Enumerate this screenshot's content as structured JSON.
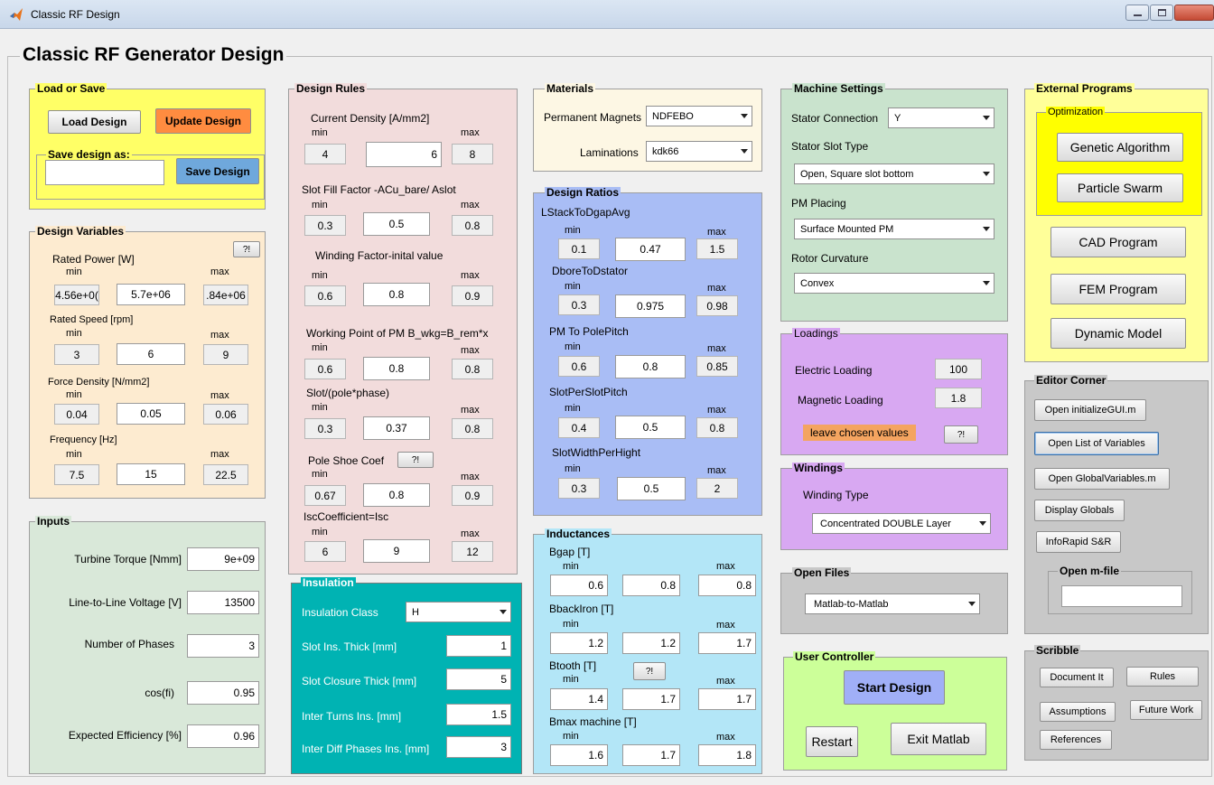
{
  "window": {
    "title": "Classic RF Design"
  },
  "main_title": "Classic RF Generator Design",
  "load_save": {
    "title": "Load or Save",
    "load": "Load Design",
    "update": "Update Design",
    "save_as_title": "Save design as:",
    "save": "Save Design",
    "filename": ""
  },
  "design_variables": {
    "title": "Design Variables",
    "help": "?!",
    "rows": [
      {
        "label": "Rated Power [W]",
        "min_label": "min",
        "max_label": "max",
        "min": "4.56e+0(",
        "value": "5.7e+06",
        "max": ".84e+06"
      },
      {
        "label": "Rated Speed [rpm]",
        "min_label": "min",
        "max_label": "max",
        "min": "3",
        "value": "6",
        "max": "9"
      },
      {
        "label": "Force Density [N/mm2]",
        "min_label": "min",
        "max_label": "max",
        "min": "0.04",
        "value": "0.05",
        "max": "0.06"
      },
      {
        "label": "Frequency [Hz]",
        "min_label": "min",
        "max_label": "max",
        "min": "7.5",
        "value": "15",
        "max": "22.5"
      }
    ]
  },
  "inputs": {
    "title": "Inputs",
    "rows": [
      {
        "label": "Turbine Torque [Nmm]",
        "value": "9e+09"
      },
      {
        "label": "Line-to-Line Voltage [V]",
        "value": "13500"
      },
      {
        "label": "Number of Phases",
        "value": "3"
      },
      {
        "label": "cos(fi)",
        "value": "0.95"
      },
      {
        "label": "Expected Efficiency [%]",
        "value": "0.96"
      }
    ]
  },
  "design_rules": {
    "title": "Design Rules",
    "help": "?!",
    "rows": [
      {
        "label": "Current Density [A/mm2]",
        "min_label": "min",
        "max_label": "max",
        "min": "4",
        "value": "6",
        "max": "8"
      },
      {
        "label": "Slot Fill Factor -ACu_bare/ Aslot",
        "min_label": "min",
        "max_label": "max",
        "min": "0.3",
        "value": "0.5",
        "max": "0.8"
      },
      {
        "label": "Winding Factor-inital value",
        "min_label": "min",
        "max_label": "max",
        "min": "0.6",
        "value": "0.8",
        "max": "0.9"
      },
      {
        "label": "Working Point of PM B_wkg=B_rem*x",
        "min_label": "min",
        "max_label": "max",
        "min": "0.6",
        "value": "0.8",
        "max": "0.8"
      },
      {
        "label": "Slot/(pole*phase)",
        "min_label": "min",
        "max_label": "max",
        "min": "0.3",
        "value": "0.37",
        "max": "0.8"
      },
      {
        "label": "Pole Shoe Coef",
        "min_label": "min",
        "max_label": "max",
        "min": "0.67",
        "value": "0.8",
        "max": "0.9"
      },
      {
        "label": "IscCoefficient=Isc",
        "min_label": "min",
        "max_label": "max",
        "min": "6",
        "value": "9",
        "max": "12"
      }
    ]
  },
  "insulation": {
    "title": "Insulation",
    "class_label": "Insulation Class",
    "class_value": "H",
    "rows": [
      {
        "label": "Slot Ins. Thick [mm]",
        "value": "1"
      },
      {
        "label": "Slot Closure Thick [mm]",
        "value": "5"
      },
      {
        "label": "Inter Turns Ins. [mm]",
        "value": "1.5"
      },
      {
        "label": "Inter Diff Phases Ins. [mm]",
        "value": "3"
      }
    ]
  },
  "materials": {
    "title": "Materials",
    "pm_label": "Permanent Magnets",
    "pm_value": "NDFEBO",
    "lam_label": "Laminations",
    "lam_value": "kdk66"
  },
  "design_ratios": {
    "title": "Design Ratios",
    "rows": [
      {
        "label": "LStackToDgapAvg",
        "min_label": "min",
        "max_label": "max",
        "min": "0.1",
        "value": "0.47",
        "max": "1.5"
      },
      {
        "label": "DboreToDstator",
        "min_label": "min",
        "max_label": "max",
        "min": "0.3",
        "value": "0.975",
        "max": "0.98"
      },
      {
        "label": "PM To PolePitch",
        "min_label": "min",
        "max_label": "max",
        "min": "0.6",
        "value": "0.8",
        "max": "0.85"
      },
      {
        "label": "SlotPerSlotPitch",
        "min_label": "min",
        "max_label": "max",
        "min": "0.4",
        "value": "0.5",
        "max": "0.8"
      },
      {
        "label": "SlotWidthPerHight",
        "min_label": "min",
        "max_label": "max",
        "min": "0.3",
        "value": "0.5",
        "max": "2"
      }
    ]
  },
  "inductances": {
    "title": "Inductances",
    "help": "?!",
    "rows": [
      {
        "label": "Bgap [T]",
        "min_label": "min",
        "max_label": "max",
        "min": "0.6",
        "value": "0.8",
        "max": "0.8"
      },
      {
        "label": "BbackIron [T]",
        "min_label": "min",
        "max_label": "max",
        "min": "1.2",
        "value": "1.2",
        "max": "1.7"
      },
      {
        "label": "Btooth [T]",
        "min_label": "min",
        "max_label": "max",
        "min": "1.4",
        "value": "1.7",
        "max": "1.7"
      },
      {
        "label": "Bmax machine [T]",
        "min_label": "min",
        "max_label": "max",
        "min": "1.6",
        "value": "1.7",
        "max": "1.8"
      }
    ]
  },
  "machine_settings": {
    "title": "Machine Settings",
    "stator_conn_label": "Stator Connection",
    "stator_conn_value": "Y",
    "slot_type_label": "Stator Slot Type",
    "slot_type_value": "Open, Square slot bottom",
    "pm_placing_label": "PM Placing",
    "pm_placing_value": "Surface Mounted PM",
    "rotor_curv_label": "Rotor Curvature",
    "rotor_curv_value": "Convex"
  },
  "loadings": {
    "title": "Loadings",
    "electric_label": "Electric Loading",
    "electric_value": "100",
    "magnetic_label": "Magnetic Loading",
    "magnetic_value": "1.8",
    "leave_label": "leave chosen values",
    "help": "?!"
  },
  "windings": {
    "title": "Windings",
    "type_label": "Winding Type",
    "type_value": "Concentrated DOUBLE Layer"
  },
  "open_files": {
    "title": "Open Files",
    "value": "Matlab-to-Matlab"
  },
  "user_controller": {
    "title": "User Controller",
    "start": "Start Design",
    "restart": "Restart",
    "exit": "Exit Matlab"
  },
  "external_programs": {
    "title": "External Programs",
    "optimization_title": "Optimization",
    "genetic": "Genetic Algorithm",
    "particle": "Particle Swarm",
    "cad": "CAD Program",
    "fem": "FEM Program",
    "dynamic": "Dynamic Model"
  },
  "editor_corner": {
    "title": "Editor Corner",
    "b1": "Open initializeGUI.m",
    "b2": "Open List of Variables",
    "b3": "Open GlobalVariables.m",
    "b4": "Display Globals",
    "b5": "InfoRapid S&R",
    "open_mfile_title": "Open m-file",
    "mfile": ""
  },
  "scribble": {
    "title": "Scribble",
    "document": "Document It",
    "rules": "Rules",
    "assumptions": "Assumptions",
    "future": "Future Work",
    "references": "References"
  },
  "colors": {
    "load_save": "#ffff66",
    "design_variables": "#fdebd0",
    "inputs": "#d9e8d9",
    "design_rules": "#f2dcdc",
    "insulation": "#00b3b3",
    "materials": "#fdf7e4",
    "design_ratios": "#a9bdf5",
    "inductances": "#b3e6f7",
    "machine_settings": "#c9e3cd",
    "loadings": "#d8a8f2",
    "windings": "#d8a8f2",
    "open_files": "#c8c8c8",
    "user_controller": "#ccff99",
    "external_programs": "#ffff99",
    "optimization": "#ffff00",
    "editor_corner": "#c8c8c8",
    "scribble": "#c8c8c8",
    "update_btn": "#ff8c40",
    "save_btn": "#6fa8dc",
    "start_btn": "#a0aff7",
    "leave_label": "#f4a460"
  }
}
